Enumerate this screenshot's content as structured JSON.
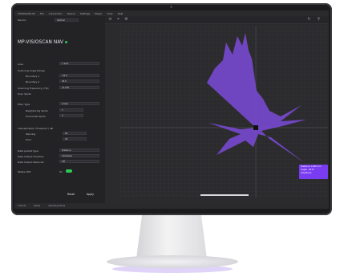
{
  "menubar": {
    "app": "VISIOSCAN GE",
    "items": [
      "File",
      "Connection",
      "Device",
      "Settings",
      "Player",
      "View",
      "Help"
    ]
  },
  "sidebar": {
    "device_label": "Device",
    "device_value": "Vertical",
    "title": "MP-VISIOSCAN NAV",
    "rows": [
      {
        "label": "Area",
        "value": "1 Spot"
      },
      {
        "label": "Scanning Angle Range",
        "value": ""
      },
      {
        "label": "Boundary 1",
        "value": "-45.0"
      },
      {
        "label": "Boundary 2",
        "value": "45.0"
      },
      {
        "label": "Scanning Frequency [ Hz]",
        "value": "21.0Hz"
      },
      {
        "label": "Scan Spots",
        "value": ""
      },
      {
        "label": "Filter Type",
        "value": "Linear"
      },
      {
        "label": "Neighboring Spots",
        "value": "5"
      },
      {
        "label": "Horizontal Spots",
        "value": "3"
      },
      {
        "label": "Intensification Threshold / dB",
        "value": ""
      },
      {
        "label": "Warning",
        "value": "60"
      },
      {
        "label": "Error",
        "value": "20"
      },
      {
        "label": "Data packet type",
        "value": "Distance"
      },
      {
        "label": "Data Output Direction",
        "value": "Clockwise"
      },
      {
        "label": "Data Output Reduced",
        "value": "Off"
      },
      {
        "label": "Status LED",
        "value": "On"
      }
    ],
    "reset_label": "Reset",
    "apply_label": "Apply"
  },
  "plot": {
    "grid": true,
    "series_color": "#7d4bd9",
    "sensor_color": "#111111"
  },
  "tooltip": {
    "line1": "Distance: 1489 mm",
    "line2": "Angle: -44.6°",
    "line3": "Amplitude"
  },
  "statusbar": {
    "left": "2 Points",
    "mid": "Ready",
    "right": "Operating Mode"
  },
  "icons": [
    "menu-icon",
    "crosshair-icon",
    "settings-icon",
    "refresh-icon",
    "zoom-icon"
  ]
}
